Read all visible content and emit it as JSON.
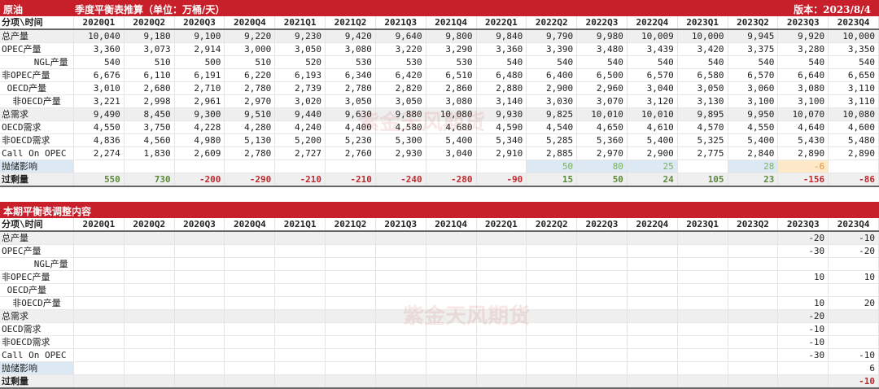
{
  "top": {
    "title_left": "原油",
    "title": "季度平衡表推算（单位：万桶/天）",
    "version": "版本：2023/8/4",
    "header_label": "分项\\时间",
    "periods": [
      "2020Q1",
      "2020Q2",
      "2020Q3",
      "2020Q4",
      "2021Q1",
      "2021Q2",
      "2021Q3",
      "2021Q4",
      "2022Q1",
      "2022Q2",
      "2022Q3",
      "2022Q4",
      "2023Q1",
      "2023Q2",
      "2023Q3",
      "2023Q4"
    ],
    "rows": [
      {
        "label": "总产量",
        "style": "gray",
        "values": [
          "10,040",
          "9,180",
          "9,100",
          "9,220",
          "9,230",
          "9,420",
          "9,640",
          "9,800",
          "9,840",
          "9,790",
          "9,980",
          "10,009",
          "10,000",
          "9,945",
          "9,920",
          "10,000"
        ]
      },
      {
        "label": "OPEC产量",
        "values": [
          "3,360",
          "3,073",
          "2,914",
          "3,000",
          "3,050",
          "3,080",
          "3,220",
          "3,290",
          "3,360",
          "3,390",
          "3,480",
          "3,439",
          "3,420",
          "3,375",
          "3,280",
          "3,350"
        ]
      },
      {
        "label": "      NGL产量",
        "values": [
          "540",
          "510",
          "500",
          "510",
          "520",
          "530",
          "530",
          "530",
          "540",
          "540",
          "540",
          "540",
          "540",
          "540",
          "540",
          "540"
        ]
      },
      {
        "label": "非OPEC产量",
        "values": [
          "6,676",
          "6,110",
          "6,191",
          "6,220",
          "6,193",
          "6,340",
          "6,420",
          "6,510",
          "6,480",
          "6,400",
          "6,500",
          "6,570",
          "6,580",
          "6,570",
          "6,640",
          "6,650"
        ]
      },
      {
        "label": " OECD产量",
        "values": [
          "3,010",
          "2,680",
          "2,710",
          "2,780",
          "2,739",
          "2,780",
          "2,820",
          "2,860",
          "2,880",
          "2,900",
          "2,960",
          "3,040",
          "3,050",
          "3,060",
          "3,080",
          "3,110"
        ]
      },
      {
        "label": "  非OECD产量",
        "values": [
          "3,221",
          "2,998",
          "2,961",
          "2,970",
          "3,020",
          "3,050",
          "3,050",
          "3,080",
          "3,140",
          "3,030",
          "3,070",
          "3,120",
          "3,130",
          "3,100",
          "3,100",
          "3,110"
        ]
      },
      {
        "label": "总需求",
        "style": "gray",
        "values": [
          "9,490",
          "8,450",
          "9,300",
          "9,510",
          "9,440",
          "9,630",
          "9,880",
          "10,080",
          "9,930",
          "9,825",
          "10,010",
          "10,010",
          "9,895",
          "9,950",
          "10,070",
          "10,080"
        ]
      },
      {
        "label": "OECD需求",
        "values": [
          "4,550",
          "3,750",
          "4,228",
          "4,280",
          "4,240",
          "4,400",
          "4,580",
          "4,680",
          "4,590",
          "4,540",
          "4,650",
          "4,610",
          "4,570",
          "4,550",
          "4,640",
          "4,600"
        ]
      },
      {
        "label": "非OECD需求",
        "values": [
          "4,836",
          "4,560",
          "4,980",
          "5,130",
          "5,200",
          "5,230",
          "5,300",
          "5,400",
          "5,340",
          "5,285",
          "5,360",
          "5,400",
          "5,325",
          "5,400",
          "5,430",
          "5,480"
        ]
      },
      {
        "label": "Call On OPEC",
        "values": [
          "2,274",
          "1,830",
          "2,609",
          "2,780",
          "2,727",
          "2,760",
          "2,930",
          "3,040",
          "2,910",
          "2,885",
          "2,970",
          "2,900",
          "2,775",
          "2,840",
          "2,890",
          "2,890"
        ]
      },
      {
        "label": "抛储影响",
        "style": "storage",
        "values": [
          "",
          "",
          "",
          "",
          "",
          "",
          "",
          "",
          "",
          "50",
          "80",
          "25",
          "",
          "28",
          "-6",
          ""
        ]
      },
      {
        "label": "过剩量",
        "style": "surplus",
        "values": [
          "550",
          "730",
          "-200",
          "-290",
          "-210",
          "-210",
          "-240",
          "-280",
          "-90",
          "15",
          "50",
          "24",
          "105",
          "23",
          "-156",
          "-86"
        ]
      }
    ]
  },
  "bottom": {
    "title": "本期平衡表调整内容",
    "header_label": "分项\\时间",
    "periods": [
      "2020Q1",
      "2020Q2",
      "2020Q3",
      "2020Q4",
      "2021Q1",
      "2021Q2",
      "2021Q3",
      "2021Q4",
      "2022Q1",
      "2022Q2",
      "2022Q3",
      "2022Q4",
      "2023Q1",
      "2023Q2",
      "2023Q3",
      "2023Q4"
    ],
    "rows": [
      {
        "label": "总产量",
        "style": "gray",
        "values": [
          "",
          "",
          "",
          "",
          "",
          "",
          "",
          "",
          "",
          "",
          "",
          "",
          "",
          "",
          "-20",
          "-10"
        ]
      },
      {
        "label": "OPEC产量",
        "values": [
          "",
          "",
          "",
          "",
          "",
          "",
          "",
          "",
          "",
          "",
          "",
          "",
          "",
          "",
          "-30",
          "-20"
        ]
      },
      {
        "label": "      NGL产量",
        "values": [
          "",
          "",
          "",
          "",
          "",
          "",
          "",
          "",
          "",
          "",
          "",
          "",
          "",
          "",
          "",
          ""
        ]
      },
      {
        "label": "非OPEC产量",
        "values": [
          "",
          "",
          "",
          "",
          "",
          "",
          "",
          "",
          "",
          "",
          "",
          "",
          "",
          "",
          "10",
          "10"
        ]
      },
      {
        "label": " OECD产量",
        "values": [
          "",
          "",
          "",
          "",
          "",
          "",
          "",
          "",
          "",
          "",
          "",
          "",
          "",
          "",
          "",
          ""
        ]
      },
      {
        "label": "  非OECD产量",
        "values": [
          "",
          "",
          "",
          "",
          "",
          "",
          "",
          "",
          "",
          "",
          "",
          "",
          "",
          "",
          "10",
          "20"
        ]
      },
      {
        "label": "总需求",
        "style": "gray",
        "values": [
          "",
          "",
          "",
          "",
          "",
          "",
          "",
          "",
          "",
          "",
          "",
          "",
          "",
          "",
          "-20",
          ""
        ]
      },
      {
        "label": "OECD需求",
        "values": [
          "",
          "",
          "",
          "",
          "",
          "",
          "",
          "",
          "",
          "",
          "",
          "",
          "",
          "",
          "-10",
          ""
        ]
      },
      {
        "label": "非OECD需求",
        "values": [
          "",
          "",
          "",
          "",
          "",
          "",
          "",
          "",
          "",
          "",
          "",
          "",
          "",
          "",
          "-10",
          ""
        ]
      },
      {
        "label": "Call On OPEC",
        "values": [
          "",
          "",
          "",
          "",
          "",
          "",
          "",
          "",
          "",
          "",
          "",
          "",
          "",
          "",
          "-30",
          "-10"
        ]
      },
      {
        "label": "抛储影响",
        "style": "storage",
        "values": [
          "",
          "",
          "",
          "",
          "",
          "",
          "",
          "",
          "",
          "",
          "",
          "",
          "",
          "",
          "",
          "6"
        ]
      },
      {
        "label": "过剩量",
        "style": "surplus",
        "values": [
          "",
          "",
          "",
          "",
          "",
          "",
          "",
          "",
          "",
          "",
          "",
          "",
          "",
          "",
          "",
          "-10"
        ]
      }
    ]
  },
  "watermark": "紫金天风期货",
  "colors": {
    "brand": "#c8202a",
    "positive": "#5a8a3a",
    "negative": "#c0282d",
    "storage_blue": "#dce9f5",
    "storage_orange": "#fde9c8"
  }
}
